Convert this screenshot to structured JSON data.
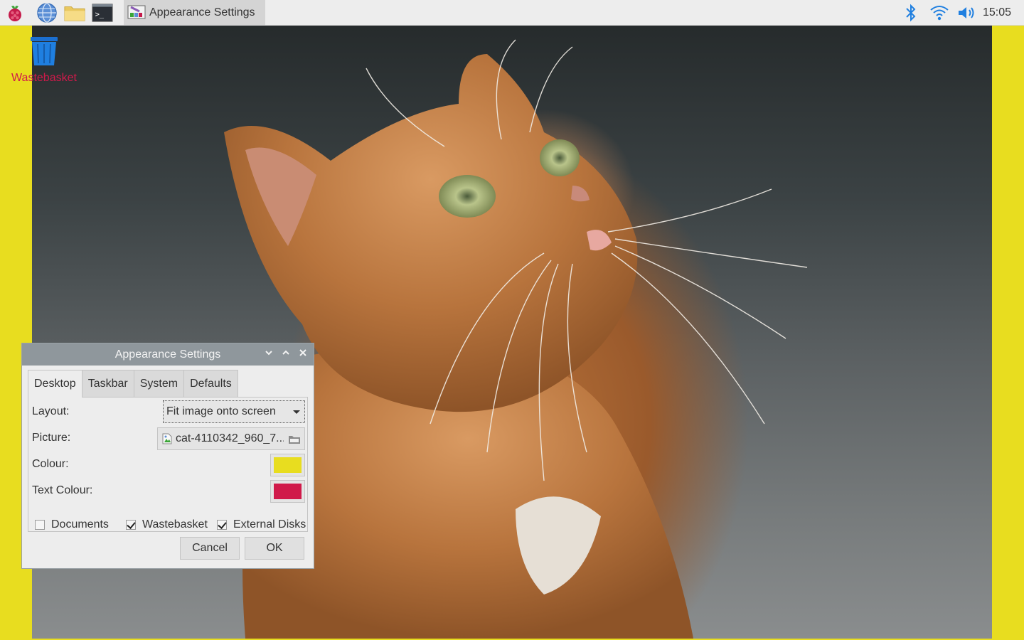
{
  "taskbar": {
    "window_title": "Appearance Settings",
    "clock": "15:05",
    "icons": [
      "raspberry-menu-icon",
      "web-browser-icon",
      "file-manager-icon",
      "terminal-icon"
    ],
    "terminal_glyph": ">_",
    "tray": [
      "bluetooth-icon",
      "wifi-icon",
      "volume-icon"
    ]
  },
  "desktop": {
    "icons": [
      {
        "label": "Wastebasket",
        "icon": "wastebasket-icon"
      }
    ],
    "label_color": "#d01a4a",
    "background_color": "#e8dd1f"
  },
  "dialog": {
    "title": "Appearance Settings",
    "controls": [
      "minimize",
      "maximize",
      "close"
    ],
    "tabs": [
      {
        "label": "Desktop",
        "active": true
      },
      {
        "label": "Taskbar",
        "active": false
      },
      {
        "label": "System",
        "active": false
      },
      {
        "label": "Defaults",
        "active": false
      }
    ],
    "fields": {
      "layout_label": "Layout:",
      "layout_value": "Fit image onto screen",
      "picture_label": "Picture:",
      "picture_value": "cat-4110342_960_7...",
      "colour_label": "Colour:",
      "colour_value": "#e8dd1f",
      "text_colour_label": "Text Colour:",
      "text_colour_value": "#d01a4a"
    },
    "checkboxes": [
      {
        "label": "Documents",
        "checked": false
      },
      {
        "label": "Wastebasket",
        "checked": true
      },
      {
        "label": "External Disks",
        "checked": true
      }
    ],
    "buttons": {
      "cancel": "Cancel",
      "ok": "OK"
    }
  }
}
